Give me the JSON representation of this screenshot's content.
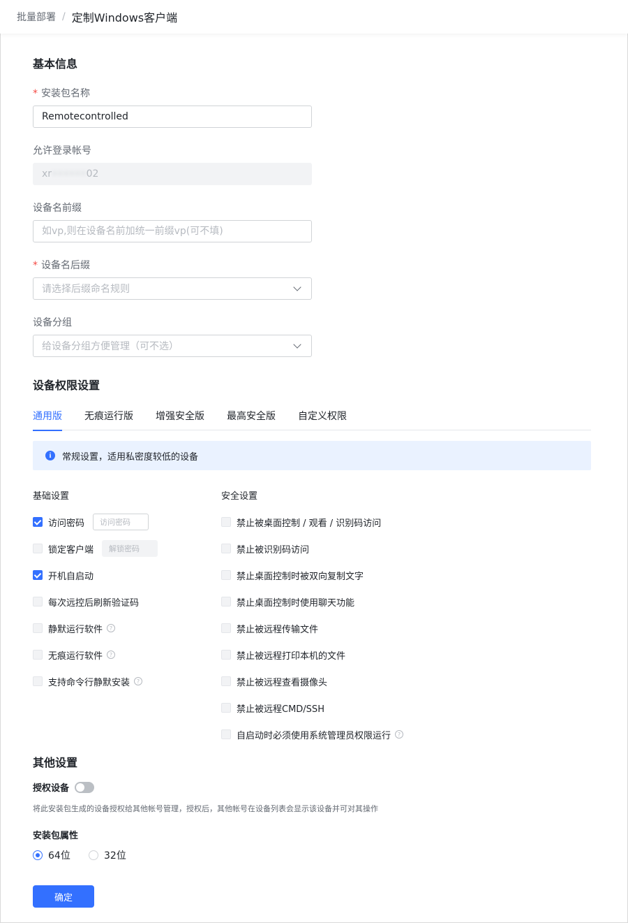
{
  "breadcrumb": {
    "root": "批量部署",
    "separator": "/",
    "current": "定制Windows客户端"
  },
  "basic_info": {
    "title": "基本信息",
    "package_name": {
      "label": "安装包名称",
      "required": true,
      "value": "Remotecontrolled"
    },
    "login_account": {
      "label": "允许登录帐号",
      "prefix": "xr",
      "masked": "••••••",
      "suffix": "02"
    },
    "device_prefix": {
      "label": "设备名前缀",
      "placeholder": "如vp,则在设备名前加统一前缀vp(可不填)"
    },
    "device_suffix": {
      "label": "设备名后缀",
      "required": true,
      "placeholder": "请选择后缀命名规则"
    },
    "device_group": {
      "label": "设备分组",
      "placeholder": "给设备分组方便管理（可不选）"
    }
  },
  "permissions": {
    "title": "设备权限设置",
    "tabs": [
      {
        "label": "通用版",
        "active": true
      },
      {
        "label": "无痕运行版",
        "active": false
      },
      {
        "label": "增强安全版",
        "active": false
      },
      {
        "label": "最高安全版",
        "active": false
      },
      {
        "label": "自定义权限",
        "active": false
      }
    ],
    "notice": "常规设置，适用私密度较低的设备",
    "basic_title": "基础设置",
    "basic": [
      {
        "label": "访问密码",
        "checked": true,
        "input_placeholder": "访问密码"
      },
      {
        "label": "锁定客户端",
        "checked": false,
        "input_placeholder": "解锁密码"
      },
      {
        "label": "开机自启动",
        "checked": true
      },
      {
        "label": "每次远控后刷新验证码",
        "checked": false
      },
      {
        "label": "静默运行软件",
        "checked": false,
        "help": true
      },
      {
        "label": "无痕运行软件",
        "checked": false,
        "help": true
      },
      {
        "label": "支持命令行静默安装",
        "checked": false,
        "help": true
      }
    ],
    "security_title": "安全设置",
    "security": [
      {
        "label": "禁止被桌面控制 / 观看 / 识别码访问",
        "checked": false
      },
      {
        "label": "禁止被识别码访问",
        "checked": false
      },
      {
        "label": "禁止桌面控制时被双向复制文字",
        "checked": false
      },
      {
        "label": "禁止桌面控制时使用聊天功能",
        "checked": false
      },
      {
        "label": "禁止被远程传输文件",
        "checked": false
      },
      {
        "label": "禁止被远程打印本机的文件",
        "checked": false
      },
      {
        "label": "禁止被远程查看摄像头",
        "checked": false
      },
      {
        "label": "禁止被远程CMD/SSH",
        "checked": false
      },
      {
        "label": "自启动时必须使用系统管理员权限运行",
        "checked": false,
        "help": true
      }
    ]
  },
  "other": {
    "title": "其他设置",
    "auth_label": "授权设备",
    "auth_enabled": false,
    "auth_desc": "将此安装包生成的设备授权给其他帐号管理，授权后，其他帐号在设备列表会显示该设备并可对其操作",
    "pkg_label": "安装包属性",
    "options": [
      {
        "label": "64位",
        "checked": true
      },
      {
        "label": "32位",
        "checked": false
      }
    ]
  },
  "confirm_label": "确定",
  "colors": {
    "primary": "#3370ff",
    "required": "#f54a45",
    "notice_bg": "#eaf2ff"
  },
  "icons": {
    "info": "info-icon",
    "chevron": "chevron-down-icon",
    "help": "question-circle-icon"
  }
}
